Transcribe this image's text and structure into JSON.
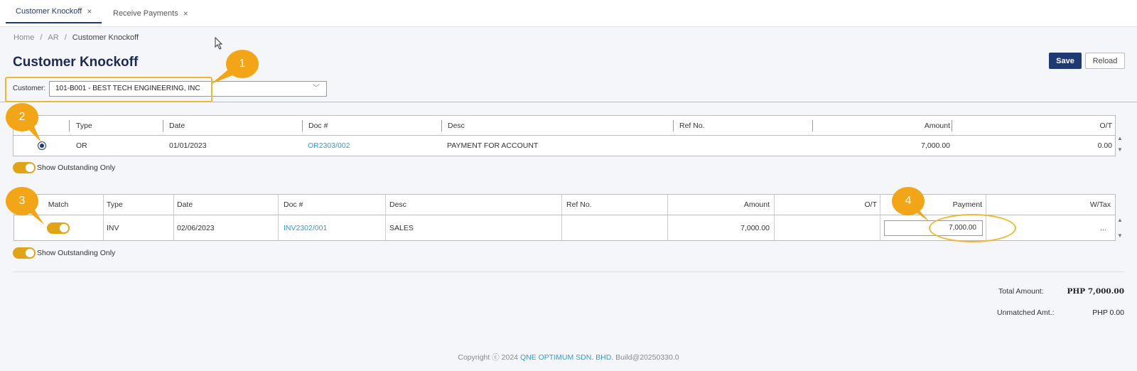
{
  "tabs": [
    {
      "label": "Customer Knockoff",
      "close": "×"
    },
    {
      "label": "Receive Payments",
      "close": "×"
    }
  ],
  "breadcrumb": [
    "Home",
    "/",
    "AR",
    "/",
    "Customer Knockoff"
  ],
  "page": {
    "title": "Customer Knockoff"
  },
  "toolbar": {
    "save_label": "Save",
    "reload_label": "Reload"
  },
  "customer": {
    "label": "Customer:",
    "value": "101-B001 - BEST TECH ENGINEERING, INC"
  },
  "receipts": {
    "headers": [
      "Type",
      "Date",
      "Doc #",
      "Desc",
      "Ref No.",
      "Amount",
      "O/T"
    ],
    "rows": [
      {
        "type": "OR",
        "date": "01/01/2023",
        "doc": "OR2303/002",
        "desc": "PAYMENT FOR ACCOUNT",
        "ref": "",
        "amount": "7,000.00",
        "ot": "0.00",
        "selected": true
      }
    ],
    "toggle_label": "Show Outstanding Only"
  },
  "invoices": {
    "headers": [
      "Match",
      "Type",
      "Date",
      "Doc #",
      "Desc",
      "Ref No.",
      "Amount",
      "O/T",
      "Payment",
      "W/Tax"
    ],
    "rows": [
      {
        "match": true,
        "type": "INV",
        "date": "02/06/2023",
        "doc": "INV2302/001",
        "desc": "SALES",
        "ref": "",
        "amount": "7,000.00",
        "ot": "",
        "payment": "7,000.00",
        "wtax": "..."
      }
    ],
    "toggle_label": "Show Outstanding Only"
  },
  "totals": {
    "total_amount_label": "Total Amount:",
    "total_amount_value": "PHP 7,000.00",
    "unmatched_label": "Unmatched Amt.:",
    "unmatched_value": "PHP 0.00"
  },
  "footer": {
    "copyright": "Copyright ⓒ 2024",
    "company": "QNE OPTIMUM SDN. BHD.",
    "build": "Build@20250330.0"
  },
  "callouts": [
    "1",
    "2",
    "3",
    "4"
  ],
  "colors": {
    "accent": "#1f3a73",
    "link": "#2a9fd6",
    "callout": "#f2a617",
    "toggle": "#e2a417"
  }
}
